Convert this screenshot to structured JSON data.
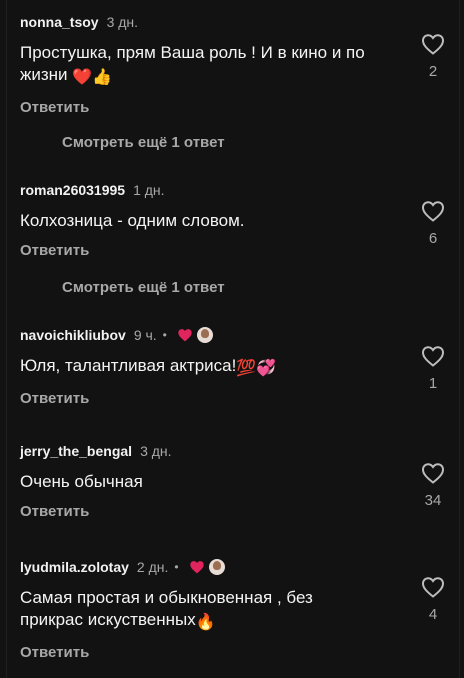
{
  "comments": [
    {
      "username": "nonna_tsoy",
      "time": "3 дн.",
      "text": "Простушка,  прям Ваша роль ! И в кино и по жизни",
      "emoji": "❤️👍",
      "reply": "Ответить",
      "likes": "2"
    },
    {
      "username": "roman26031995",
      "time": "1 дн.",
      "text": "Колхозница - одним словом.",
      "emoji": "",
      "reply": "Ответить",
      "likes": "6"
    },
    {
      "username": "navoichikliubov",
      "time": "9 ч.",
      "dot": "•",
      "text": "Юля, талантливая актриса!",
      "emoji": "💯💞",
      "reply": "Ответить",
      "likes": "1"
    },
    {
      "username": "jerry_the_bengal",
      "time": "3 дн.",
      "text": "Очень обычная",
      "emoji": "",
      "reply": "Ответить",
      "likes": "34"
    },
    {
      "username": "lyudmila.zolotay",
      "time": "2 дн.",
      "dot": "•",
      "text": "Самая простая и обыкновенная , без прикрас искуственных",
      "emoji": "🔥",
      "reply": "Ответить",
      "likes": "4"
    }
  ],
  "view_more": [
    "Смотреть ещё 1 ответ",
    "Смотреть ещё 1 ответ"
  ],
  "colors": {
    "background": "#121212",
    "text": "#f2f2f2",
    "secondary": "#a8a8a8",
    "heart_badge": "#e0245e"
  },
  "icons": {
    "like": "heart-outline-icon",
    "creator_like": "red-heart-icon"
  }
}
